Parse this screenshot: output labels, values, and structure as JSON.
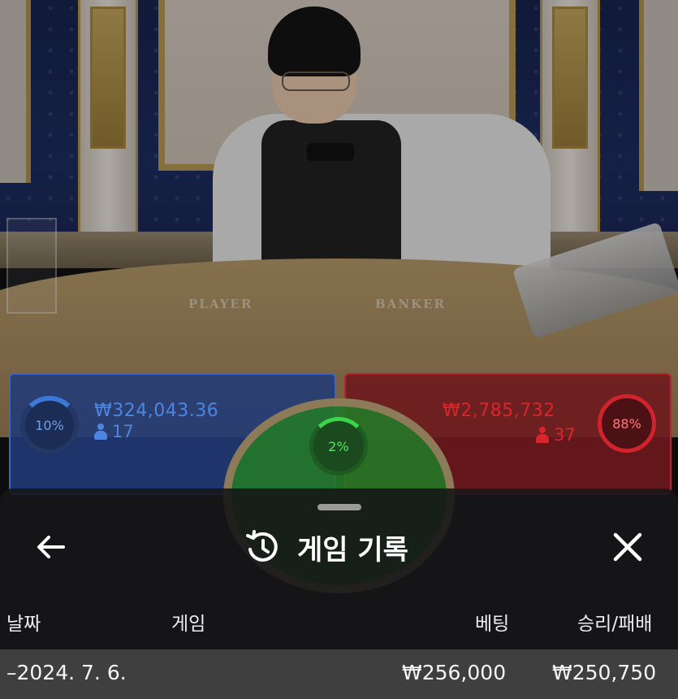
{
  "video": {
    "table_labels": {
      "player": "PLAYER",
      "banker": "BANKER"
    }
  },
  "betting": {
    "player": {
      "percent": "10%",
      "amount": "₩324,043.36",
      "bettors": "17",
      "color": "#3c78d8"
    },
    "tie": {
      "percent": "2%",
      "color": "#3ad54a"
    },
    "banker": {
      "percent": "88%",
      "amount": "₩2,785,732",
      "bettors": "37",
      "color": "#d1232b"
    }
  },
  "sheet": {
    "title": "게임 기록",
    "title_icon": "history-icon",
    "back_icon": "arrow-left-icon",
    "close_icon": "close-icon",
    "columns": {
      "date": "날짜",
      "game": "게임",
      "bet": "베팅",
      "win_loss": "승리/패배"
    },
    "rows": [
      {
        "prefix": "–",
        "date": "2024. 7. 6.",
        "bet": "₩256,000",
        "win_loss": "₩250,750"
      }
    ]
  }
}
